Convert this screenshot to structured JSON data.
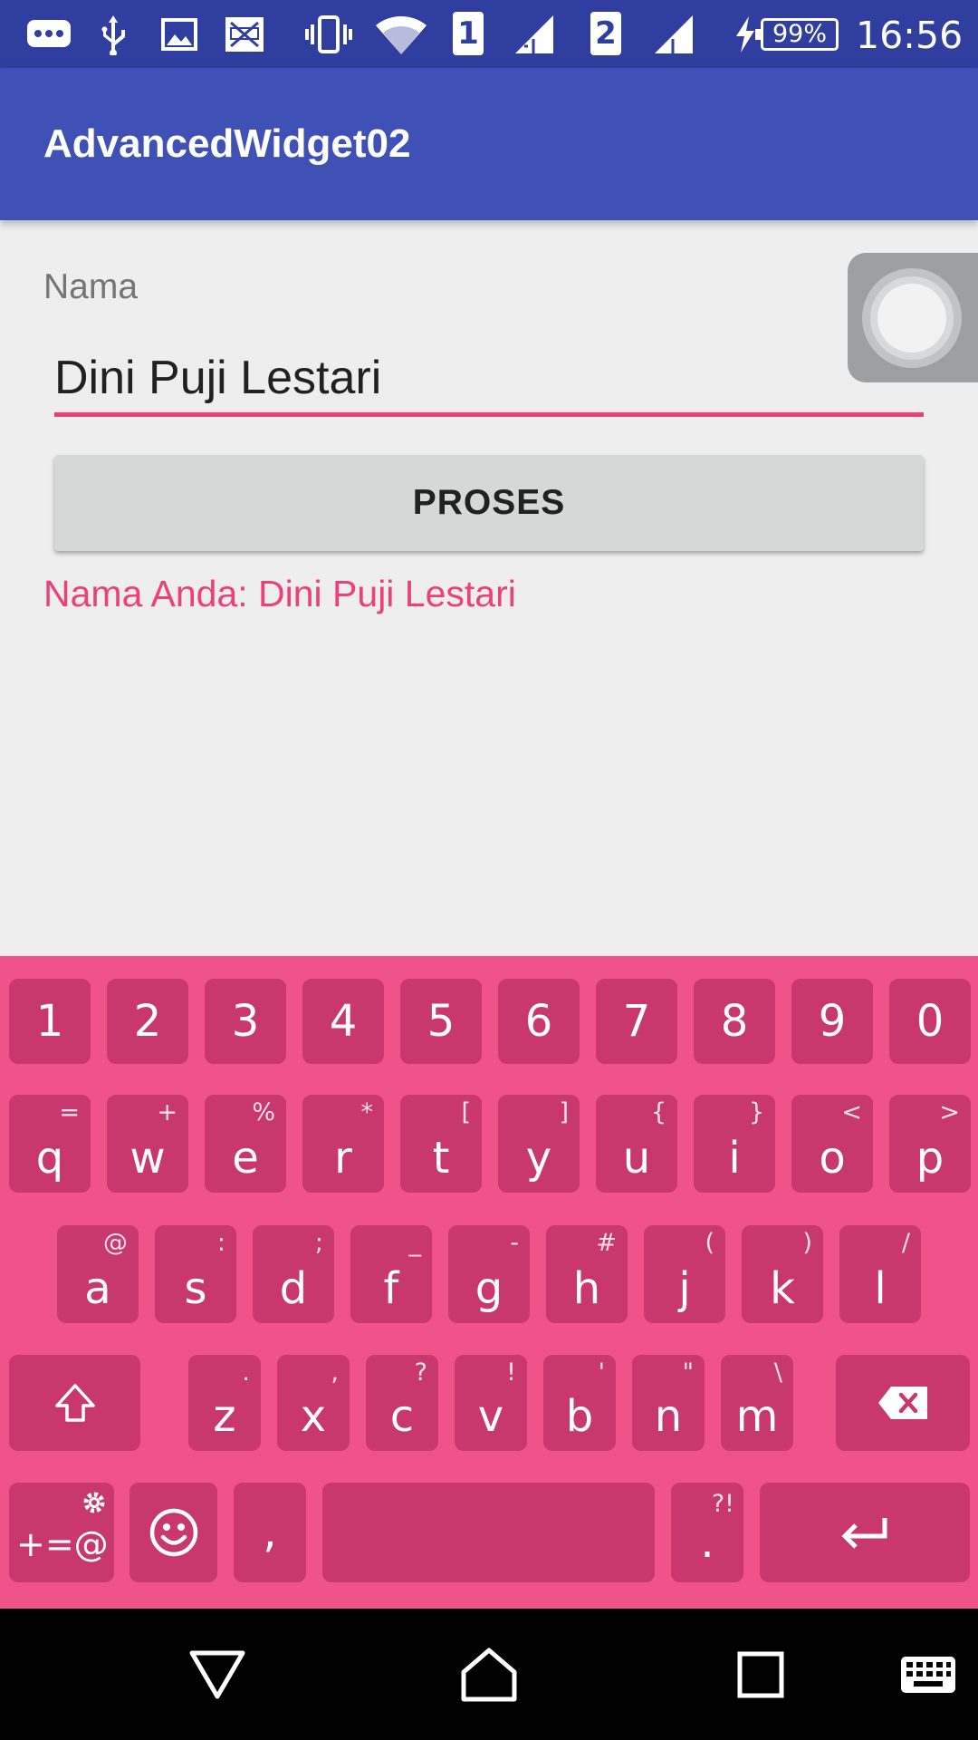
{
  "status_bar": {
    "icons": [
      "more-icon",
      "usb-icon",
      "image-icon",
      "screenshot-icon",
      "vibrate-icon",
      "wifi-icon",
      "sim1-signal-icon",
      "sim2-signal-icon",
      "charging-icon"
    ],
    "sim1_label": "1",
    "sim2_label": "2",
    "battery": "99%",
    "time": "16:56"
  },
  "app_bar": {
    "title": "AdvancedWidget02"
  },
  "form": {
    "label": "Nama",
    "input_value": "Dini Puji Lestari",
    "button_label": "PROSES",
    "result": "Nama Anda: Dini Puji Lestari"
  },
  "keyboard": {
    "number_row": [
      "1",
      "2",
      "3",
      "4",
      "5",
      "6",
      "7",
      "8",
      "9",
      "0"
    ],
    "row1": [
      {
        "key": "q",
        "hint": "="
      },
      {
        "key": "w",
        "hint": "+"
      },
      {
        "key": "e",
        "hint": "%"
      },
      {
        "key": "r",
        "hint": "*"
      },
      {
        "key": "t",
        "hint": "["
      },
      {
        "key": "y",
        "hint": "]"
      },
      {
        "key": "u",
        "hint": "{"
      },
      {
        "key": "i",
        "hint": "}"
      },
      {
        "key": "o",
        "hint": "<"
      },
      {
        "key": "p",
        "hint": ">"
      }
    ],
    "row2": [
      {
        "key": "a",
        "hint": "@"
      },
      {
        "key": "s",
        "hint": ":"
      },
      {
        "key": "d",
        "hint": ";"
      },
      {
        "key": "f",
        "hint": "_"
      },
      {
        "key": "g",
        "hint": "-"
      },
      {
        "key": "h",
        "hint": "#"
      },
      {
        "key": "j",
        "hint": "("
      },
      {
        "key": "k",
        "hint": ")"
      },
      {
        "key": "l",
        "hint": "/"
      }
    ],
    "row3": [
      {
        "key": "z",
        "hint": "."
      },
      {
        "key": "x",
        "hint": ","
      },
      {
        "key": "c",
        "hint": "?"
      },
      {
        "key": "v",
        "hint": "!"
      },
      {
        "key": "b",
        "hint": "'"
      },
      {
        "key": "n",
        "hint": "\""
      },
      {
        "key": "m",
        "hint": "\\"
      }
    ],
    "symbols_label": "+=@",
    "comma_label": ",",
    "period_label": ".",
    "period_hint": "?!",
    "colors": {
      "background": "#f0528a",
      "key": "#c9386c",
      "accent": "#ec407a",
      "primary": "#3f51b5",
      "primary_dark": "#303f9f"
    }
  },
  "nav_bar": {
    "icons": [
      "back-icon",
      "home-icon",
      "recents-icon",
      "keyboard-switch-icon"
    ]
  }
}
